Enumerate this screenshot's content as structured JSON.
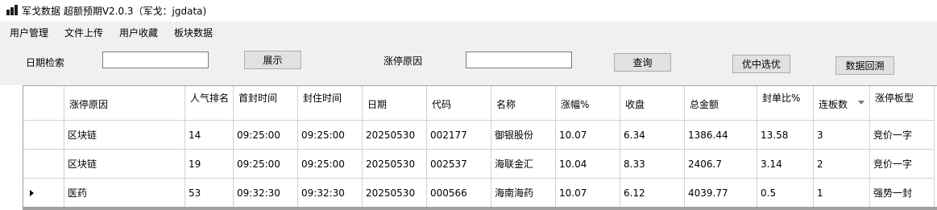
{
  "window": {
    "title": "军戈数据 超额预期V2.0.3（军戈：jgdata)"
  },
  "menu": {
    "items": [
      "用户管理",
      "文件上传",
      "用户收藏",
      "板块数据"
    ]
  },
  "toolbar": {
    "date_search_label": "日期检索",
    "date_search_value": "",
    "show_button": "展示",
    "reason_label": "涨停原因",
    "reason_value": "",
    "query_button": "查询",
    "pick_best_button": "优中选优",
    "backtest_button": "数据回溯"
  },
  "table": {
    "columns": [
      {
        "key": "reason",
        "label": "涨停原因"
      },
      {
        "key": "popularity",
        "label": "人气排名"
      },
      {
        "key": "first_seal",
        "label": "首封时间"
      },
      {
        "key": "seal_time",
        "label": "封住时间"
      },
      {
        "key": "date",
        "label": "日期"
      },
      {
        "key": "code",
        "label": "代码"
      },
      {
        "key": "name",
        "label": "名称"
      },
      {
        "key": "change_pct",
        "label": "涨幅%"
      },
      {
        "key": "close",
        "label": "收盘"
      },
      {
        "key": "amount",
        "label": "总金额"
      },
      {
        "key": "seal_ratio",
        "label": "封单比%"
      },
      {
        "key": "streak",
        "label": "连板数"
      },
      {
        "key": "board_type",
        "label": "涨停板型"
      }
    ],
    "sorted_column": "streak",
    "current_row": 2,
    "rows": [
      [
        "区块链",
        "14",
        "09:25:00",
        "09:25:00",
        "20250530",
        "002177",
        "御银股份",
        "10.07",
        "6.34",
        "1386.44",
        "13.58",
        "3",
        "竞价一字"
      ],
      [
        "区块链",
        "19",
        "09:25:00",
        "09:25:00",
        "20250530",
        "002537",
        "海联金汇",
        "10.04",
        "8.33",
        "2406.7",
        "3.14",
        "2",
        "竞价一字"
      ],
      [
        "医药",
        "53",
        "09:32:30",
        "09:32:30",
        "20250530",
        "000566",
        "海南海药",
        "10.07",
        "6.12",
        "4039.77",
        "0.5",
        "1",
        "强势一封"
      ]
    ]
  }
}
